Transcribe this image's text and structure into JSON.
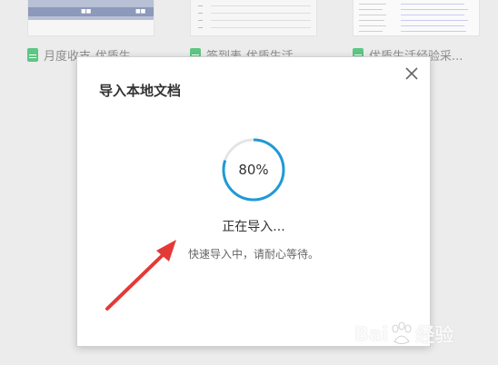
{
  "background_cards": [
    {
      "title": "月度收支-优质生..."
    },
    {
      "title": "签到表-优质生活..."
    },
    {
      "title": "优质生活经验采..."
    }
  ],
  "dialog": {
    "title": "导入本地文档",
    "progress": {
      "percent": 80,
      "label": "80%"
    },
    "status_text": "正在导入...",
    "hint_text": "快速导入中，请耐心等待。"
  },
  "watermark": {
    "text_left": "Bai",
    "text_right": "经验"
  },
  "colors": {
    "progress_accent": "#1f9ad6",
    "progress_track": "#e5e5e5",
    "arrow": "#e53935",
    "sheet_icon": "#5cc683"
  }
}
